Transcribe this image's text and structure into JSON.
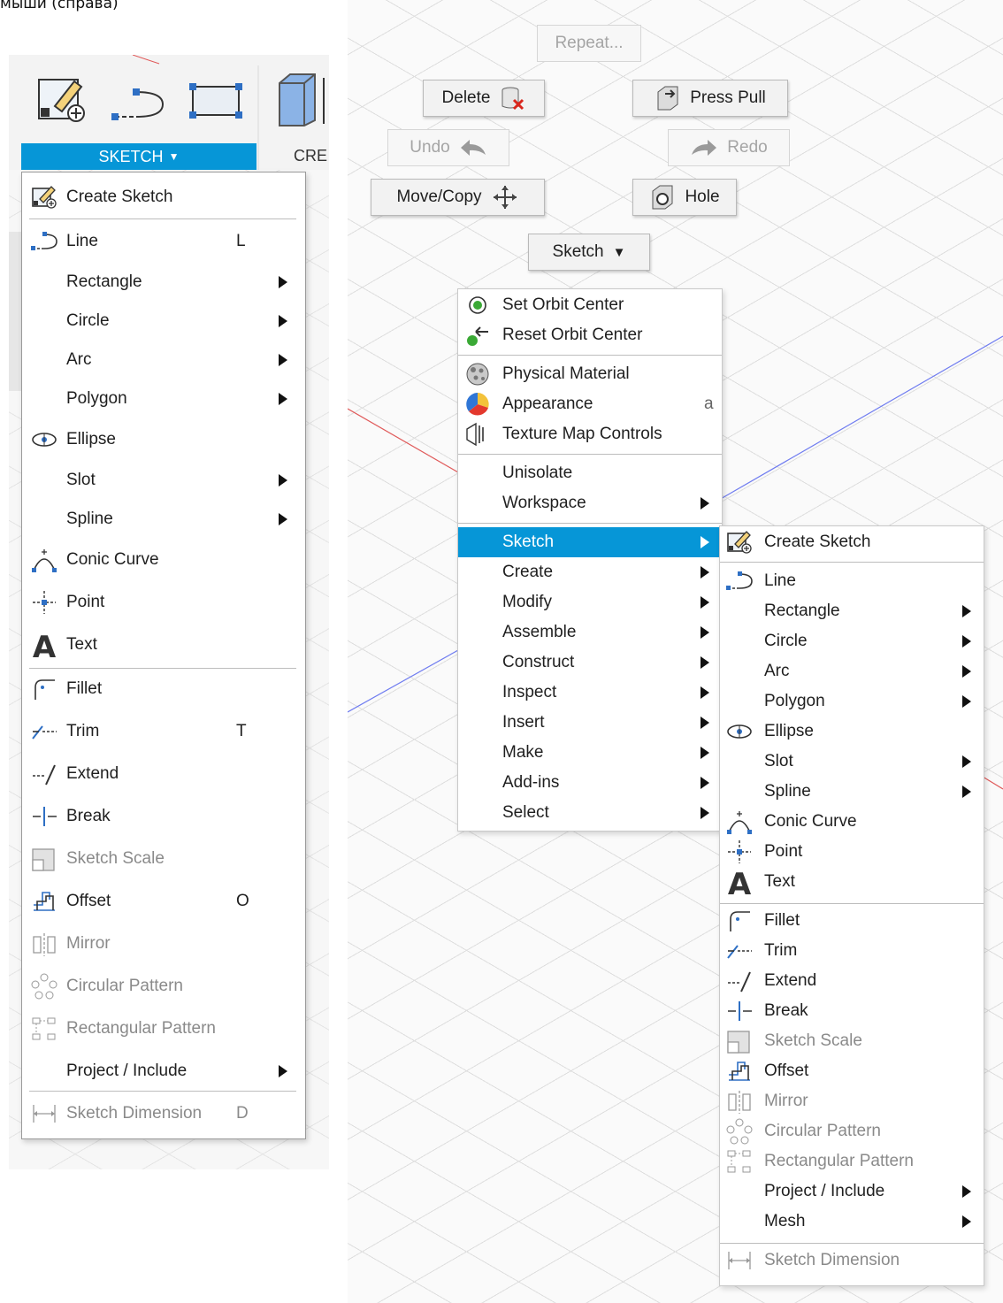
{
  "caption": "мыши (справа)",
  "left": {
    "sketch_tab": "SKETCH",
    "create_tab": "CRE",
    "items": [
      {
        "label": "Create Sketch",
        "icon": "create-sketch-icon"
      },
      {
        "label": "Line",
        "shortcut": "L",
        "icon": "line-icon"
      },
      {
        "label": "Rectangle",
        "submenu": true
      },
      {
        "label": "Circle",
        "submenu": true
      },
      {
        "label": "Arc",
        "submenu": true
      },
      {
        "label": "Polygon",
        "submenu": true
      },
      {
        "label": "Ellipse",
        "icon": "ellipse-icon"
      },
      {
        "label": "Slot",
        "submenu": true
      },
      {
        "label": "Spline",
        "submenu": true
      },
      {
        "label": "Conic Curve",
        "icon": "conic-curve-icon"
      },
      {
        "label": "Point",
        "icon": "point-icon"
      },
      {
        "label": "Text",
        "icon": "text-icon"
      },
      {
        "label": "Fillet",
        "icon": "fillet-icon"
      },
      {
        "label": "Trim",
        "shortcut": "T",
        "icon": "trim-icon"
      },
      {
        "label": "Extend",
        "icon": "extend-icon"
      },
      {
        "label": "Break",
        "icon": "break-icon"
      },
      {
        "label": "Sketch Scale",
        "icon": "sketch-scale-icon",
        "disabled": true
      },
      {
        "label": "Offset",
        "shortcut": "O",
        "icon": "offset-icon"
      },
      {
        "label": "Mirror",
        "icon": "mirror-icon",
        "disabled": true
      },
      {
        "label": "Circular Pattern",
        "icon": "circular-pattern-icon",
        "disabled": true
      },
      {
        "label": "Rectangular Pattern",
        "icon": "rectangular-pattern-icon",
        "disabled": true
      },
      {
        "label": "Project / Include",
        "submenu": true
      },
      {
        "label": "Sketch Dimension",
        "shortcut": "D",
        "icon": "sketch-dimension-icon",
        "disabled": true
      }
    ]
  },
  "marking_menu": {
    "repeat": "Repeat...",
    "delete": "Delete",
    "press_pull": "Press Pull",
    "undo": "Undo",
    "redo": "Redo",
    "move_copy": "Move/Copy",
    "hole": "Hole",
    "sketch": "Sketch"
  },
  "context_menu": {
    "items": [
      {
        "label": "Set Orbit Center",
        "icon": "orbit-center-icon"
      },
      {
        "label": "Reset Orbit Center",
        "icon": "reset-orbit-icon"
      },
      {
        "label": "Physical Material",
        "icon": "physical-material-icon"
      },
      {
        "label": "Appearance",
        "icon": "appearance-icon",
        "shortcut": "a"
      },
      {
        "label": "Texture Map Controls",
        "icon": "texture-map-icon"
      },
      {
        "label": "Unisolate"
      },
      {
        "label": "Workspace",
        "submenu": true
      },
      {
        "label": "Sketch",
        "submenu": true,
        "highlighted": true
      },
      {
        "label": "Create",
        "submenu": true
      },
      {
        "label": "Modify",
        "submenu": true
      },
      {
        "label": "Assemble",
        "submenu": true
      },
      {
        "label": "Construct",
        "submenu": true
      },
      {
        "label": "Inspect",
        "submenu": true
      },
      {
        "label": "Insert",
        "submenu": true
      },
      {
        "label": "Make",
        "submenu": true
      },
      {
        "label": "Add-ins",
        "submenu": true
      },
      {
        "label": "Select",
        "submenu": true
      }
    ]
  },
  "sketch_submenu": {
    "items": [
      {
        "label": "Create Sketch"
      },
      {
        "label": "Line"
      },
      {
        "label": "Rectangle",
        "submenu": true
      },
      {
        "label": "Circle",
        "submenu": true
      },
      {
        "label": "Arc",
        "submenu": true
      },
      {
        "label": "Polygon",
        "submenu": true
      },
      {
        "label": "Ellipse"
      },
      {
        "label": "Slot",
        "submenu": true
      },
      {
        "label": "Spline",
        "submenu": true
      },
      {
        "label": "Conic Curve"
      },
      {
        "label": "Point"
      },
      {
        "label": "Text"
      },
      {
        "label": "Fillet"
      },
      {
        "label": "Trim"
      },
      {
        "label": "Extend"
      },
      {
        "label": "Break"
      },
      {
        "label": "Sketch Scale",
        "disabled": true
      },
      {
        "label": "Offset"
      },
      {
        "label": "Mirror",
        "disabled": true
      },
      {
        "label": "Circular Pattern",
        "disabled": true
      },
      {
        "label": "Rectangular Pattern",
        "disabled": true
      },
      {
        "label": "Project / Include",
        "submenu": true
      },
      {
        "label": "Mesh",
        "submenu": true
      },
      {
        "label": "Sketch Dimension",
        "disabled": true
      }
    ]
  },
  "colors": {
    "accent": "#0696d7",
    "axis_red": "#e05a5a",
    "axis_blue": "#6f7cf0"
  }
}
